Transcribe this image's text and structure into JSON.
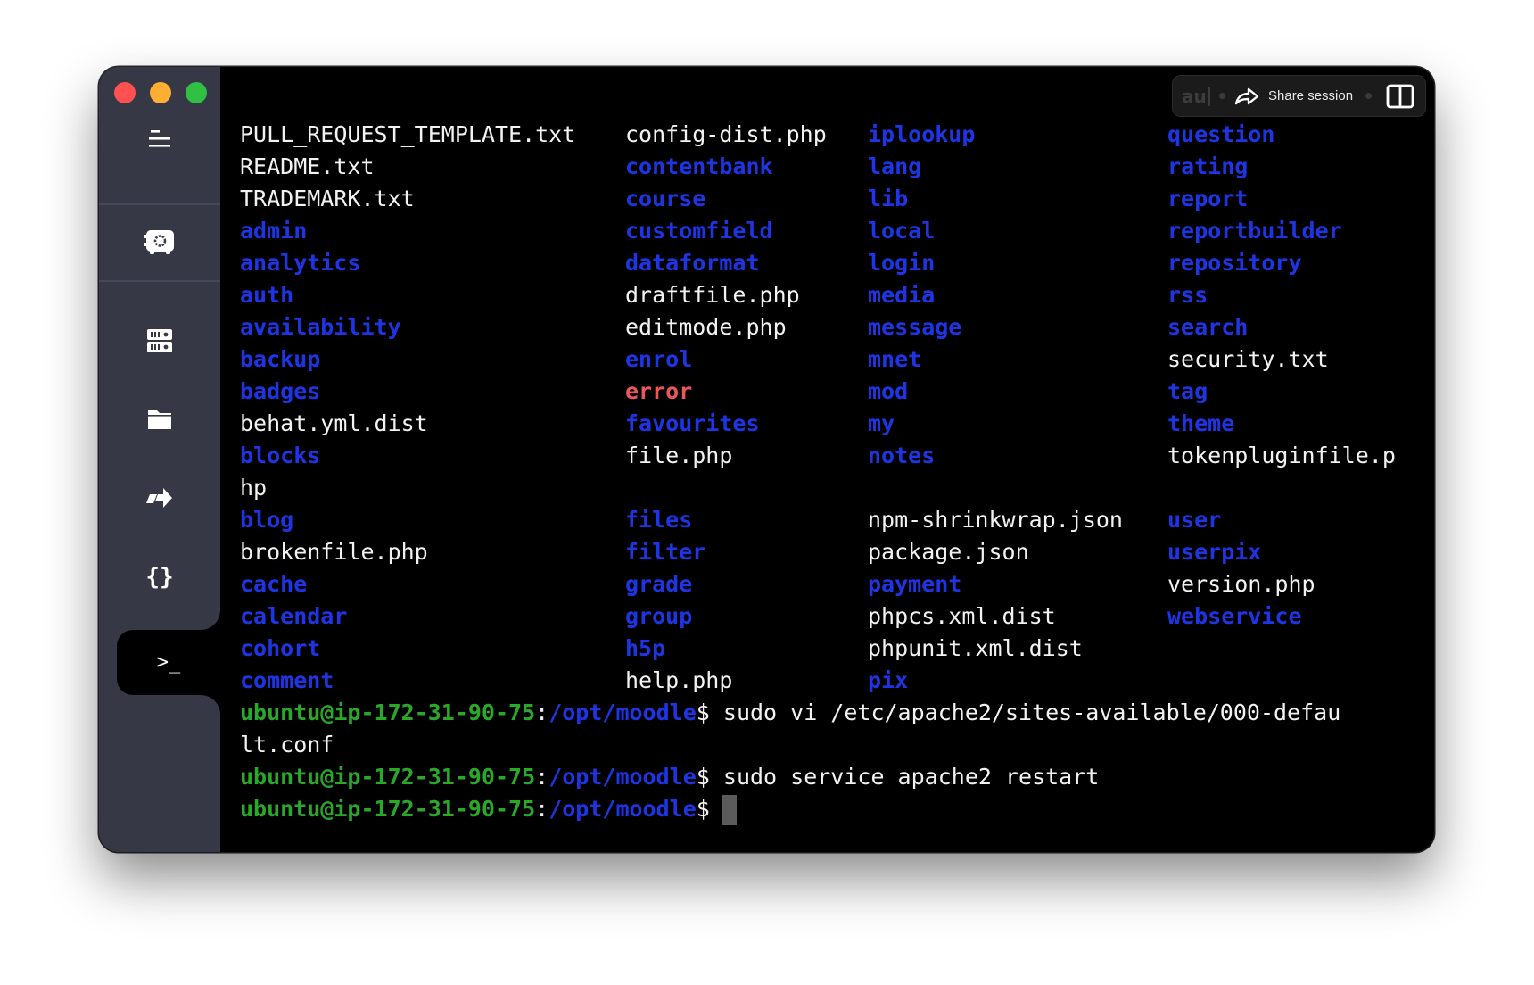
{
  "window": {
    "controls": [
      "close",
      "minimize",
      "maximize"
    ]
  },
  "sidebar": {
    "items": [
      {
        "name": "menu",
        "icon": "menu-icon"
      },
      {
        "name": "vaults",
        "icon": "vault-icon"
      },
      {
        "name": "hosts",
        "icon": "server-icon"
      },
      {
        "name": "sftp",
        "icon": "folder-icon"
      },
      {
        "name": "port-forwarding",
        "icon": "forward-icon"
      },
      {
        "name": "snippets",
        "icon": "braces-icon"
      },
      {
        "name": "terminal",
        "icon": "terminal-icon",
        "glyph": ">_",
        "active": true
      }
    ]
  },
  "toolbar": {
    "input_value": "au",
    "share_label": "Share session",
    "share_icon": "share-arrow-icon",
    "split_icon": "split-view-icon"
  },
  "terminal": {
    "colors": {
      "directory": "#1f35e4",
      "file": "#f2f2f2",
      "error": "#e8585c",
      "prompt_user": "#2aa82a",
      "prompt_path": "#1f35e4"
    },
    "listing_rows": [
      [
        {
          "t": "PULL_REQUEST_TEMPLATE.txt",
          "k": "file"
        },
        {
          "t": "config-dist.php",
          "k": "file"
        },
        {
          "t": "iplookup",
          "k": "dir"
        },
        {
          "t": "question",
          "k": "dir"
        }
      ],
      [
        {
          "t": "README.txt",
          "k": "file"
        },
        {
          "t": "contentbank",
          "k": "dir"
        },
        {
          "t": "lang",
          "k": "dir"
        },
        {
          "t": "rating",
          "k": "dir"
        }
      ],
      [
        {
          "t": "TRADEMARK.txt",
          "k": "file"
        },
        {
          "t": "course",
          "k": "dir"
        },
        {
          "t": "lib",
          "k": "dir"
        },
        {
          "t": "report",
          "k": "dir"
        }
      ],
      [
        {
          "t": "admin",
          "k": "dir"
        },
        {
          "t": "customfield",
          "k": "dir"
        },
        {
          "t": "local",
          "k": "dir"
        },
        {
          "t": "reportbuilder",
          "k": "dir"
        }
      ],
      [
        {
          "t": "analytics",
          "k": "dir"
        },
        {
          "t": "dataformat",
          "k": "dir"
        },
        {
          "t": "login",
          "k": "dir"
        },
        {
          "t": "repository",
          "k": "dir"
        }
      ],
      [
        {
          "t": "auth",
          "k": "dir"
        },
        {
          "t": "draftfile.php",
          "k": "file"
        },
        {
          "t": "media",
          "k": "dir"
        },
        {
          "t": "rss",
          "k": "dir"
        }
      ],
      [
        {
          "t": "availability",
          "k": "dir"
        },
        {
          "t": "editmode.php",
          "k": "file"
        },
        {
          "t": "message",
          "k": "dir"
        },
        {
          "t": "search",
          "k": "dir"
        }
      ],
      [
        {
          "t": "backup",
          "k": "dir"
        },
        {
          "t": "enrol",
          "k": "dir"
        },
        {
          "t": "mnet",
          "k": "dir"
        },
        {
          "t": "security.txt",
          "k": "file"
        }
      ],
      [
        {
          "t": "badges",
          "k": "dir"
        },
        {
          "t": "error",
          "k": "err"
        },
        {
          "t": "mod",
          "k": "dir"
        },
        {
          "t": "tag",
          "k": "dir"
        }
      ],
      [
        {
          "t": "behat.yml.dist",
          "k": "file"
        },
        {
          "t": "favourites",
          "k": "dir"
        },
        {
          "t": "my",
          "k": "dir"
        },
        {
          "t": "theme",
          "k": "dir"
        }
      ],
      [
        {
          "t": "blocks",
          "k": "dir"
        },
        {
          "t": "file.php",
          "k": "file"
        },
        {
          "t": "notes",
          "k": "dir"
        },
        {
          "t": "tokenpluginfile.p",
          "k": "file"
        }
      ],
      [
        {
          "t": "hp",
          "k": "file"
        },
        {
          "t": "",
          "k": "file"
        },
        {
          "t": "",
          "k": "file"
        },
        {
          "t": "",
          "k": "file"
        }
      ],
      [
        {
          "t": "blog",
          "k": "dir"
        },
        {
          "t": "files",
          "k": "dir"
        },
        {
          "t": "npm-shrinkwrap.json",
          "k": "file"
        },
        {
          "t": "user",
          "k": "dir"
        }
      ],
      [
        {
          "t": "brokenfile.php",
          "k": "file"
        },
        {
          "t": "filter",
          "k": "dir"
        },
        {
          "t": "package.json",
          "k": "file"
        },
        {
          "t": "userpix",
          "k": "dir"
        }
      ],
      [
        {
          "t": "cache",
          "k": "dir"
        },
        {
          "t": "grade",
          "k": "dir"
        },
        {
          "t": "payment",
          "k": "dir"
        },
        {
          "t": "version.php",
          "k": "file"
        }
      ],
      [
        {
          "t": "calendar",
          "k": "dir"
        },
        {
          "t": "group",
          "k": "dir"
        },
        {
          "t": "phpcs.xml.dist",
          "k": "file"
        },
        {
          "t": "webservice",
          "k": "dir"
        }
      ],
      [
        {
          "t": "cohort",
          "k": "dir"
        },
        {
          "t": "h5p",
          "k": "dir"
        },
        {
          "t": "phpunit.xml.dist",
          "k": "file"
        },
        {
          "t": "",
          "k": "file"
        }
      ],
      [
        {
          "t": "comment",
          "k": "dir"
        },
        {
          "t": "help.php",
          "k": "file"
        },
        {
          "t": "pix",
          "k": "dir"
        },
        {
          "t": "",
          "k": "file"
        }
      ]
    ],
    "prompt": {
      "user_host": "ubuntu@ip-172-31-90-75",
      "colon": ":",
      "path": "/opt/moodle",
      "dollar": "$"
    },
    "commands": [
      {
        "cmd": " sudo vi /etc/apache2/sites-available/000-defau",
        "wrap": "lt.conf"
      },
      {
        "cmd": " sudo service apache2 restart"
      },
      {
        "cmd": ""
      }
    ]
  }
}
